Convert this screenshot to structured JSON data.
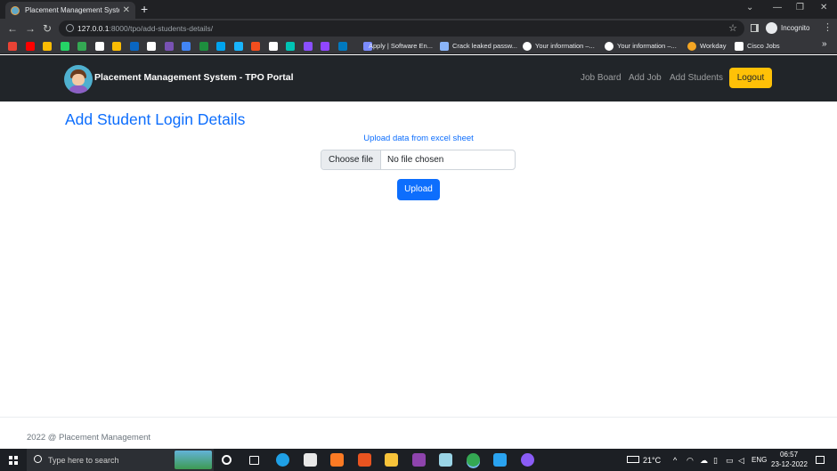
{
  "browser": {
    "tab_title": "Placement Management System",
    "url_host": "127.0.0.1",
    "url_path": ":8000/tpo/add-students-details/",
    "profile_label": "Incognito",
    "bookmarks": [
      {
        "label": "Apply | Software En...",
        "icon": "gem-icon",
        "color": "#7b8cff"
      },
      {
        "label": "Crack leaked passw...",
        "icon": "diamond-icon",
        "color": "#8ab4f8"
      },
      {
        "label": "Your information –...",
        "icon": "google-icon",
        "color": "#ffffff"
      },
      {
        "label": "Your information –...",
        "icon": "google-icon",
        "color": "#ffffff"
      },
      {
        "label": "Workday",
        "icon": "workday-icon",
        "color": "#f5a623"
      },
      {
        "label": "Cisco Jobs",
        "icon": "cisco-icon",
        "color": "#ffffff"
      }
    ],
    "bookmark_icon_colors": [
      "#ea4335",
      "#ff0000",
      "#fbbc04",
      "#25d366",
      "#34a853",
      "#ffffff",
      "#fbbc04",
      "#0a66c2",
      "#ffffff",
      "#7952b3",
      "#4285f4",
      "#1e8e3e",
      "#00a4ef",
      "#19b5fe",
      "#f24e1e",
      "#ffffff",
      "#00c4b4",
      "#8a4fff",
      "#9146ff",
      "#0079bf"
    ]
  },
  "navbar": {
    "brand": "Placement Management System - TPO Portal",
    "links": [
      "Job Board",
      "Add Job",
      "Add Students"
    ],
    "logout_label": "Logout"
  },
  "main": {
    "title": "Add Student Login Details",
    "upload_label": "Upload data from excel sheet",
    "file_button_label": "Choose file",
    "file_status": "No file chosen",
    "upload_button_label": "Upload"
  },
  "footer": {
    "text": "2022 @ Placement Management"
  },
  "taskbar": {
    "search_placeholder": "Type here to search",
    "apps": [
      {
        "name": "cortana-icon",
        "color": "#ffffff"
      },
      {
        "name": "task-view-icon",
        "color": "#ffffff"
      },
      {
        "name": "edge-icon",
        "color": "#1fa0e6"
      },
      {
        "name": "cloud-app-icon",
        "color": "#e8e8e8"
      },
      {
        "name": "xampp-icon",
        "color": "#fb7a24"
      },
      {
        "name": "ubuntu-icon",
        "color": "#e95420"
      },
      {
        "name": "file-explorer-icon",
        "color": "#f8c33a"
      },
      {
        "name": "git-icon",
        "color": "#8e44ad"
      },
      {
        "name": "notepad-icon",
        "color": "#9ad4e6"
      },
      {
        "name": "chrome-icon",
        "color": "#34a853"
      },
      {
        "name": "vscode-icon",
        "color": "#2aa3f0"
      },
      {
        "name": "github-desktop-icon",
        "color": "#8a5cf6"
      }
    ],
    "weather": "21°C",
    "language": "ENG",
    "time": "06:57",
    "date": "23-12-2022"
  }
}
